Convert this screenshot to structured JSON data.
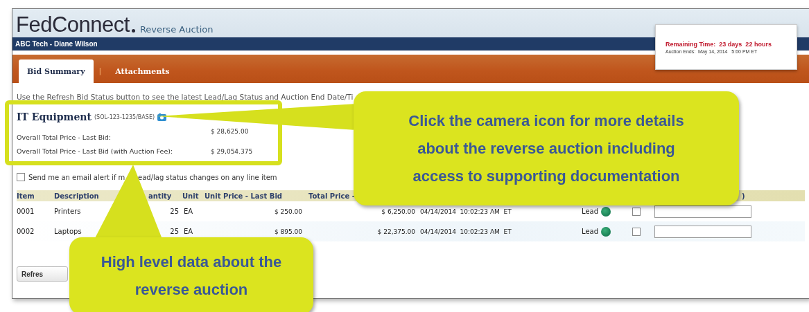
{
  "header": {
    "logo": "FedConnect",
    "subtitle": "Reverse Auction"
  },
  "user_bar": {
    "name": "ABC Tech - Diane Wilson"
  },
  "tabs": [
    {
      "label": "Bid Summary",
      "selected": true
    },
    {
      "label": "Attachments",
      "selected": false
    }
  ],
  "tab_separator": "|",
  "timer": {
    "remaining": "Remaining Time:  23 days  22 hours",
    "ends": "Auction Ends:  May 14, 2014   5:00 PM ET"
  },
  "info_text": "Use the Refresh Bid Status button to see the latest Lead/Lag Status and Auction End Date/Ti",
  "auction": {
    "title": "IT Equipment",
    "solicitation": "(SOL-123-1235/BASE)",
    "totals": [
      {
        "label": "Overall Total Price - Last Bid:",
        "value": "$ 28,625.00"
      },
      {
        "label": "Overall Total Price - Last Bid (with Auction Fee):",
        "value": "$ 29,054.375"
      }
    ]
  },
  "email_alert": {
    "checked": false,
    "text_parts": [
      "Send me an email alert if m",
      "ead/lag status changes on any line item"
    ]
  },
  "table": {
    "columns": [
      "Item",
      "Description",
      "antity",
      "Unit",
      "Unit Price - Last Bid",
      "Total Price -",
      ")"
    ],
    "rows": [
      {
        "item": "0001",
        "description": "Printers",
        "quantity": "25",
        "unit": "EA",
        "unit_price": "$ 250.00",
        "total_price": "$ 6,250.00",
        "bid_time": "04/14/2014  10:02:23 AM  ET",
        "status": "Lead",
        "checked": false
      },
      {
        "item": "0002",
        "description": "Laptops",
        "quantity": "25",
        "unit": "EA",
        "unit_price": "$ 895.00",
        "total_price": "$ 22,375.00",
        "bid_time": "04/14/2014  10:02:23 AM  ET",
        "status": "Lead",
        "checked": false
      }
    ]
  },
  "refresh_button": "Refres",
  "callouts": [
    {
      "text": "Click the camera icon for more details about the reverse auction including access to supporting documentation"
    },
    {
      "text": "High level data about the reverse auction"
    }
  ]
}
